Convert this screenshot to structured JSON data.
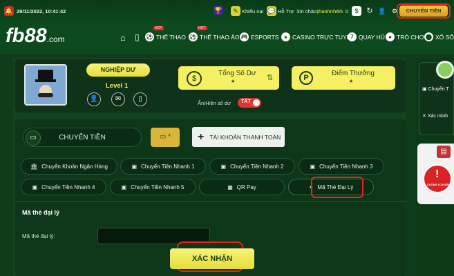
{
  "topbar": {
    "datetime": "29/11/2022, 10:41:42",
    "khieu_nai": "Khiếu nại",
    "ho_tro": "Hỗ Trợ",
    "greeting": "Xin chào,",
    "username": "thanhnhi95",
    "balance": "0",
    "transfer_button": "CHUYỂN TIỀN"
  },
  "brand": {
    "logo": "fb88",
    "suffix": ".com"
  },
  "nav": {
    "items": [
      {
        "label": "THỂ THAO",
        "badge": "HOT"
      },
      {
        "label": "THỂ THAO ẢO",
        "badge": "HOT"
      },
      {
        "label": "ESPORTS"
      },
      {
        "label": "CASINO TRỰC TUYẾN"
      },
      {
        "label": "QUAY HŨ"
      },
      {
        "label": "TRÒ CHƠI"
      },
      {
        "label": "XỔ SỐ"
      }
    ]
  },
  "profile": {
    "rank": "NGHIỆP DƯ",
    "level": "Level 1",
    "total_balance_label": "Tổng Số Dư",
    "total_balance_value": "*",
    "points_label": "Điểm Thưởng",
    "points_value": "*",
    "toggle_label": "Ẩn/Hiện số dư",
    "toggle_state": "TẮT"
  },
  "transfer": {
    "tab_transfer": "CHUYỂN TIỀN",
    "tab_wallet_value": "*",
    "tab_accounts": "TÀI KHOẢN THANH TOÁN",
    "methods": [
      "Chuyển Khoản Ngân Hàng",
      "Chuyển Tiền Nhanh 1",
      "Chuyển Tiền Nhanh 2",
      "Chuyển Tiền Nhanh 3",
      "Chuyển Tiền Nhanh 4",
      "Chuyển Tiền Nhanh 5",
      "QR Pay",
      "Mã Thẻ Đại Lý"
    ],
    "section_title": "Mã thẻ đại lý",
    "field_label": "Mã thẻ đại lý:",
    "field_value": "",
    "submit": "XÁC NHẬN"
  },
  "sidebar": {
    "items": [
      "Chuyển T",
      "Xác minh"
    ],
    "badge": "CHỐNG LỪA ĐẢO"
  },
  "colors": {
    "accent_yellow": "#f4ef63",
    "highlight_red": "#e8231f",
    "bg_green": "#0f3d1c"
  }
}
